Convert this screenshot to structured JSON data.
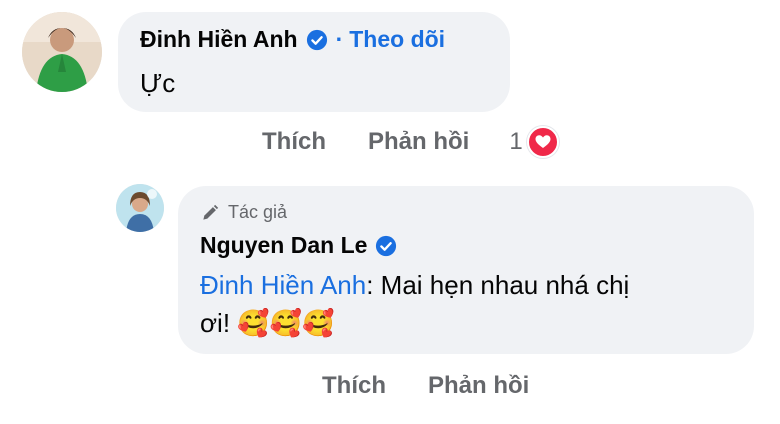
{
  "comment": {
    "author": "Đinh Hiền Anh",
    "verified": true,
    "follow_separator": "·",
    "follow_label": "Theo dõi",
    "text": "Ực",
    "actions": {
      "like_label": "Thích",
      "reply_label": "Phản hồi",
      "reaction_count": "1",
      "reaction_icon": "heart-icon"
    }
  },
  "reply": {
    "author_badge": "Tác giả",
    "author": "Nguyen Dan Le",
    "verified": true,
    "mention": "Đinh Hiền Anh",
    "text_after_mention": ": Mai hẹn nhau nhá chị",
    "text_line2": "ơi!",
    "emojis": [
      "🥰",
      "🥰",
      "🥰"
    ],
    "actions": {
      "like_label": "Thích",
      "reply_label": "Phản hồi"
    }
  },
  "colors": {
    "bubble": "#f0f2f5",
    "link_blue": "#1a6fe0",
    "secondary_text": "#65676b",
    "heart_red": "#f02849"
  }
}
